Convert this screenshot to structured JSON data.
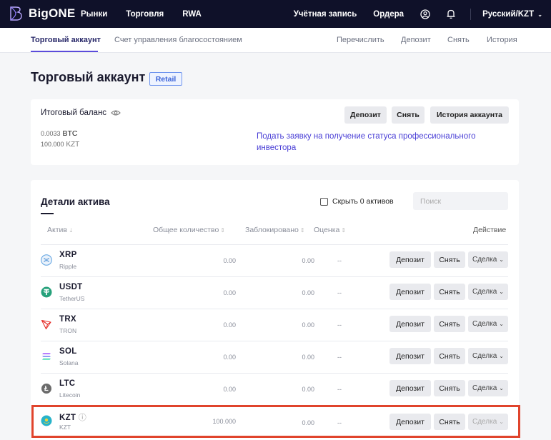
{
  "topnav": {
    "logo": "BigONE",
    "items": [
      "Рынки",
      "Торговля",
      "RWA"
    ],
    "account": "Учётная запись",
    "orders": "Ордера",
    "language": "Русский/KZT"
  },
  "subnav": {
    "tabs": [
      "Торговый аккаунт",
      "Счет управления благосостоянием"
    ],
    "actions": [
      "Перечислить",
      "Депозит",
      "Снять",
      "История"
    ]
  },
  "page": {
    "title": "Торговый аккаунт",
    "badge": "Retail"
  },
  "balance": {
    "label": "Итоговый баланс",
    "btc_amount": "0.0033",
    "btc_unit": "BTC",
    "kzt_amount": "100.000",
    "kzt_unit": "KZT",
    "pro_link": "Подать заявку на получение статуса профессионального инвестора",
    "buttons": {
      "deposit": "Депозит",
      "withdraw": "Снять",
      "history": "История аккаунта"
    }
  },
  "assets": {
    "title": "Детали актива",
    "hide_zero": "Скрыть 0 активов",
    "search_placeholder": "Поиск",
    "columns": {
      "asset": "Актив",
      "total": "Общее количество",
      "locked": "Заблокировано",
      "value": "Оценка",
      "action": "Действие"
    },
    "rows": [
      {
        "symbol": "XRP",
        "name": "Ripple",
        "total": "0.00",
        "locked": "0.00",
        "value": "--",
        "icon": "xrp-icon"
      },
      {
        "symbol": "USDT",
        "name": "TetherUS",
        "total": "0.00",
        "locked": "0.00",
        "value": "--",
        "icon": "usdt-icon"
      },
      {
        "symbol": "TRX",
        "name": "TRON",
        "total": "0.00",
        "locked": "0.00",
        "value": "--",
        "icon": "trx-icon"
      },
      {
        "symbol": "SOL",
        "name": "Solana",
        "total": "0.00",
        "locked": "0.00",
        "value": "--",
        "icon": "sol-icon"
      },
      {
        "symbol": "LTC",
        "name": "Litecoin",
        "total": "0.00",
        "locked": "0.00",
        "value": "--",
        "icon": "ltc-icon"
      },
      {
        "symbol": "KZT",
        "name": "KZT",
        "total": "100.000",
        "locked": "0.00",
        "value": "--",
        "icon": "kzt-flag-icon"
      }
    ],
    "row_buttons": {
      "deposit": "Депозит",
      "withdraw": "Снять",
      "trade": "Сделка"
    }
  },
  "colors": {
    "nav_bg": "#0f1129",
    "accent": "#5b4bdb",
    "highlight": "#e0442c",
    "link": "#4a3fd6"
  }
}
